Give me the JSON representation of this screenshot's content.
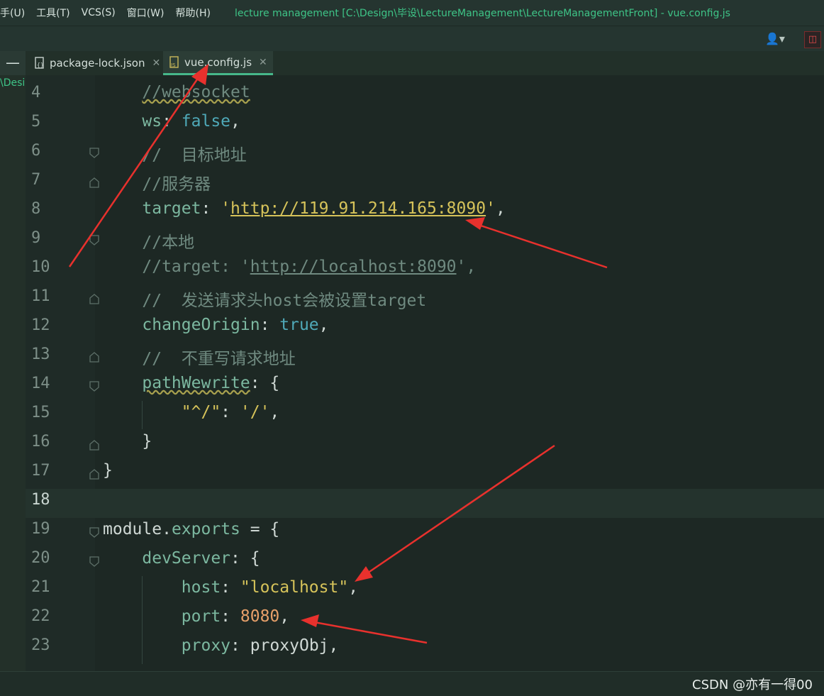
{
  "menu": {
    "items": [
      "手(U)",
      "工具(T)",
      "VCS(S)",
      "窗口(W)",
      "帮助(H)"
    ],
    "window_title": "lecture management [C:\\Design\\毕设\\LectureManagement\\LectureManagementFront] - vue.config.js"
  },
  "toolbar": {
    "user_icon": "user-icon",
    "right_icon": "layout-icon"
  },
  "tabs": [
    {
      "label": "package-lock.json",
      "icon": "json-file-icon",
      "active": false
    },
    {
      "label": "vue.config.js",
      "icon": "js-file-icon",
      "active": true
    }
  ],
  "sidebar": {
    "path_fragment": "\\Desi"
  },
  "editor": {
    "current_line": 18,
    "lines": [
      {
        "n": "4"
      },
      {
        "n": "5"
      },
      {
        "n": "6"
      },
      {
        "n": "7"
      },
      {
        "n": "8"
      },
      {
        "n": "9"
      },
      {
        "n": "10"
      },
      {
        "n": "11"
      },
      {
        "n": "12"
      },
      {
        "n": "13"
      },
      {
        "n": "14"
      },
      {
        "n": "15"
      },
      {
        "n": "16"
      },
      {
        "n": "17"
      },
      {
        "n": "18"
      },
      {
        "n": "19"
      },
      {
        "n": "20"
      },
      {
        "n": "21"
      },
      {
        "n": "22"
      },
      {
        "n": "23"
      }
    ],
    "code": {
      "l4": "//websocket",
      "l5_key": "ws",
      "l5_val": "false",
      "l6": "//  目标地址",
      "l7": "//服务器",
      "l8_key": "target",
      "l8_url": "http://119.91.214.165:8090",
      "l9": "//本地",
      "l10_pre": "//target: '",
      "l10_url": "http://localhost:8090",
      "l10_post": "',",
      "l11": "//  发送请求头host会被设置target",
      "l12_key": "changeOrigin",
      "l12_val": "true",
      "l13": "//  不重写请求地址",
      "l14_key": "pathWewrite",
      "l15_key": "\"^/\"",
      "l15_val": "'/'",
      "l16": "}",
      "l17": "}",
      "l19_obj": "module",
      "l19_prop": "exports",
      "l20_key": "devServer",
      "l21_key": "host",
      "l21_val": "\"localhost\"",
      "l22_key": "port",
      "l22_val": "8080",
      "l23_key": "proxy",
      "l23_val": "proxyObj"
    }
  },
  "annotations": {
    "arrow_color": "#e8312d"
  },
  "watermark": "CSDN @亦有一得00"
}
